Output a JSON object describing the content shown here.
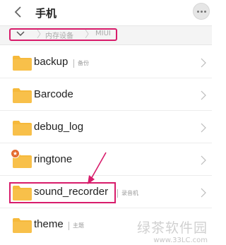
{
  "header": {
    "title": "手机",
    "back_icon": "chevron-left-icon",
    "more_icon": "more-icon"
  },
  "breadcrumb": {
    "segments": [
      "内存设备",
      "MIUI"
    ],
    "toggle_icon": "chevron-down-icon"
  },
  "files": [
    {
      "name": "backup",
      "desc": "备份",
      "badge": null
    },
    {
      "name": "Barcode",
      "desc": "",
      "badge": null
    },
    {
      "name": "debug_log",
      "desc": "",
      "badge": null
    },
    {
      "name": "ringtone",
      "desc": "",
      "badge": "★"
    },
    {
      "name": "sound_recorder",
      "desc": "录音机",
      "badge": null
    },
    {
      "name": "theme",
      "desc": "主题",
      "badge": null
    }
  ],
  "colors": {
    "folder": "#f6b93b",
    "folder_dark": "#e9a420",
    "highlight": "#d81c6b",
    "badge": "#e46a2e"
  },
  "watermark": {
    "text": "绿茶软件园",
    "url": "www.33LC.com"
  }
}
